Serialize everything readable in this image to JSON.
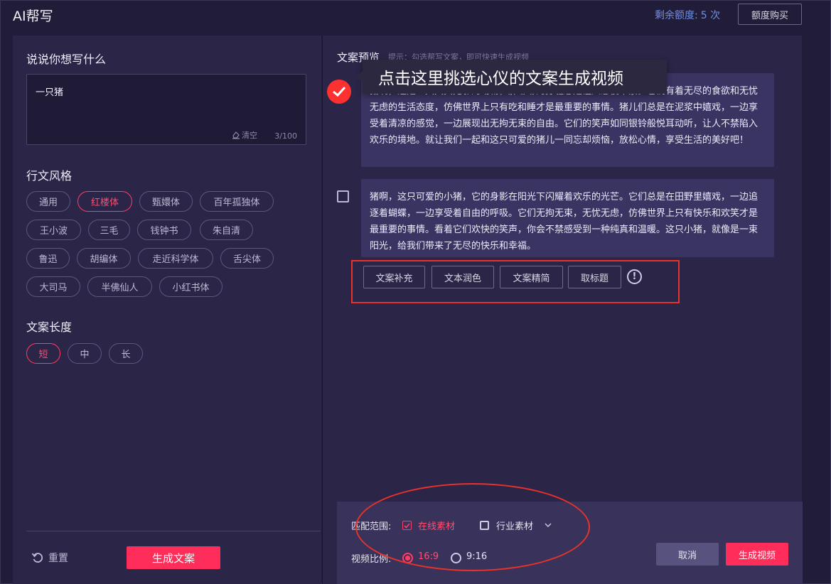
{
  "header": {
    "title": "AI帮写",
    "quota_label": "剩余额度:",
    "quota_value": "5 次",
    "buy_label": "额度购买"
  },
  "left": {
    "prompt_title": "说说你想写什么",
    "prompt_value": "一只猪",
    "clear_label": "清空",
    "counter": "3/100",
    "style_title": "行文风格",
    "styles": [
      "通用",
      "红楼体",
      "甄嬛体",
      "百年孤独体",
      "王小波",
      "三毛",
      "钱钟书",
      "朱自清",
      "鲁迅",
      "胡编体",
      "走近科学体",
      "舌尖体",
      "大司马",
      "半佛仙人",
      "小红书体"
    ],
    "selected_style": "红楼体",
    "length_title": "文案长度",
    "lengths": [
      "短",
      "中",
      "长"
    ],
    "selected_length": "短",
    "reset_label": "重置",
    "generate_label": "生成文案"
  },
  "right": {
    "preview_title": "文案预览",
    "preview_hint": "提示：勾选帮写文案，即可快速生成视频",
    "tooltip": "点击这里挑选心仪的文案生成视频",
    "cards": [
      {
        "text": "猪啊，这是一只天真无邪的动物，胖嘟嘟的身躯总是让人忍俊不禁。它们有着无尽的食欲和无忧无虑的生活态度，仿佛世界上只有吃和睡才是最重要的事情。猪儿们总是在泥浆中嬉戏，一边享受着清凉的感觉，一边展现出无拘无束的自由。它们的笑声如同银铃般悦耳动听，让人不禁陷入欢乐的境地。就让我们一起和这只可爱的猪儿一同忘却烦恼，放松心情，享受生活的美好吧！",
        "checked": true
      },
      {
        "text": "猪啊，这只可爱的小猪，它的身影在阳光下闪耀着欢乐的光芒。它们总是在田野里嬉戏，一边追逐着蝴蝶，一边享受着自由的呼吸。它们无拘无束，无忧无虑，仿佛世界上只有快乐和欢笑才是最重要的事情。看着它们欢快的笑声，你会不禁感受到一种纯真和温暖。这只小猪，就像是一束阳光，给我们带来了无尽的快乐和幸福。",
        "checked": false
      }
    ],
    "tools": [
      "文案补充",
      "文本润色",
      "文案精简",
      "取标题"
    ],
    "match_label": "匹配范围:",
    "match_options": [
      {
        "label": "在线素材",
        "checked": true
      },
      {
        "label": "行业素材",
        "checked": false
      }
    ],
    "ratio_label": "视频比例:",
    "ratios": [
      {
        "label": "16:9",
        "selected": true
      },
      {
        "label": "9:16",
        "selected": false
      }
    ],
    "cancel_label": "取消",
    "generate_video_label": "生成视频"
  },
  "colors": {
    "accent": "#ff2d5a",
    "annotation_red": "#e8322a",
    "quota_blue": "#6f8fe6"
  }
}
